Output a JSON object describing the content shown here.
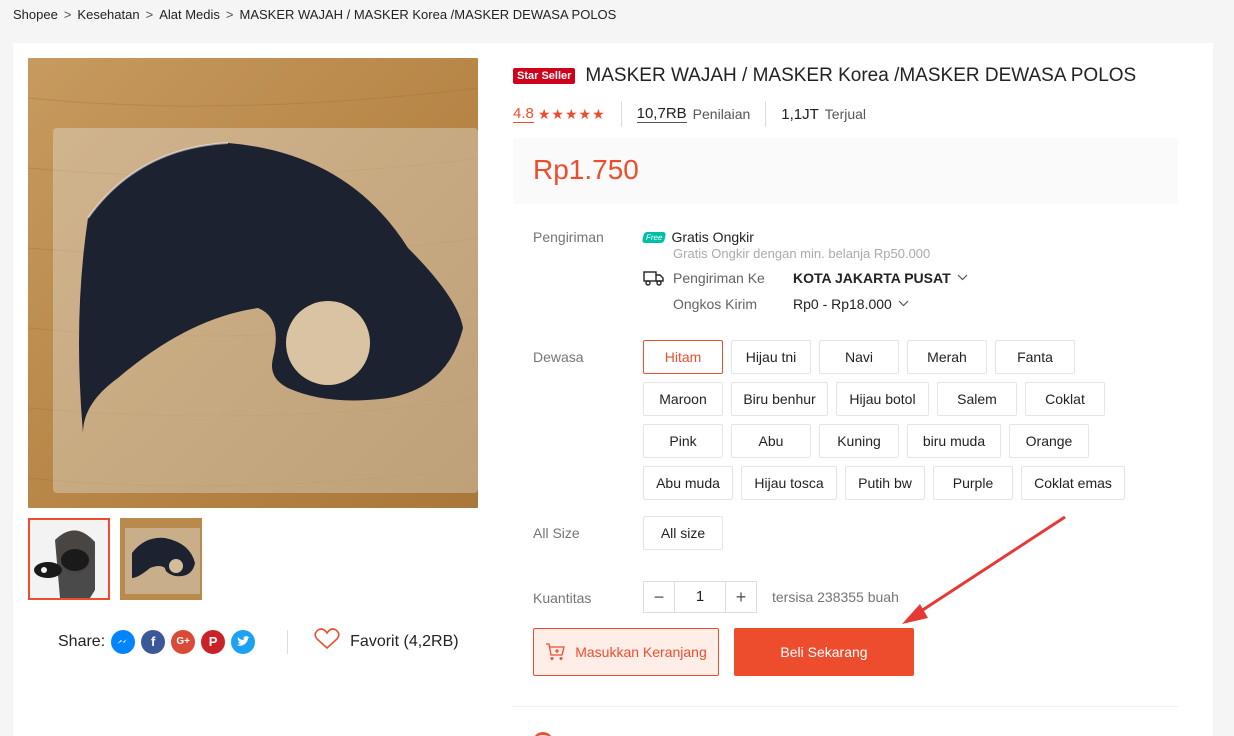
{
  "breadcrumb": {
    "items": [
      "Shopee",
      "Kesehatan",
      "Alat Medis",
      "MASKER WAJAH / MASKER Korea /MASKER DEWASA POLOS"
    ],
    "separator": ">"
  },
  "product": {
    "badge": "Star Seller",
    "title": "MASKER WAJAH / MASKER Korea /MASKER DEWASA POLOS",
    "rating": "4.8",
    "stars": "★★★★★",
    "reviews_count": "10,7RB",
    "reviews_label": "Penilaian",
    "sold_count": "1,1JT",
    "sold_label": "Terjual",
    "price": "Rp1.750"
  },
  "shipping": {
    "label": "Pengiriman",
    "free_badge": "Free",
    "free_title": "Gratis Ongkir",
    "free_sub": "Gratis Ongkir dengan min. belanja Rp50.000",
    "to_label": "Pengiriman Ke",
    "to_value": "KOTA JAKARTA PUSAT",
    "cost_label": "Ongkos Kirim",
    "cost_value": "Rp0 - Rp18.000"
  },
  "variations": {
    "color_label": "Dewasa",
    "rows": [
      [
        "Hitam",
        "Hijau tni",
        "Navi",
        "Merah",
        "Fanta"
      ],
      [
        "Maroon",
        "Biru benhur",
        "Hijau botol",
        "Salem",
        "Coklat"
      ],
      [
        "Pink",
        "Abu",
        "Kuning",
        "biru muda",
        "Orange"
      ],
      [
        "Abu muda",
        "Hijau tosca",
        "Putih bw",
        "Purple",
        "Coklat emas"
      ]
    ],
    "selected": "Hitam",
    "size_label": "All Size",
    "size_options": [
      "All size"
    ]
  },
  "quantity": {
    "label": "Kuantitas",
    "value": "1",
    "minus": "−",
    "plus": "+",
    "stock": "tersisa 238355 buah"
  },
  "actions": {
    "cart": "Masukkan Keranjang",
    "buy": "Beli Sekarang"
  },
  "share": {
    "label": "Share:",
    "favorite": "Favorit (4,2RB)",
    "icons": [
      "messenger-icon",
      "facebook-icon",
      "google-plus-icon",
      "pinterest-icon",
      "twitter-icon"
    ]
  },
  "colors": {
    "accent": "#ee4d2d",
    "star_seller": "#d0011b",
    "free_badge": "#00bfa5"
  }
}
